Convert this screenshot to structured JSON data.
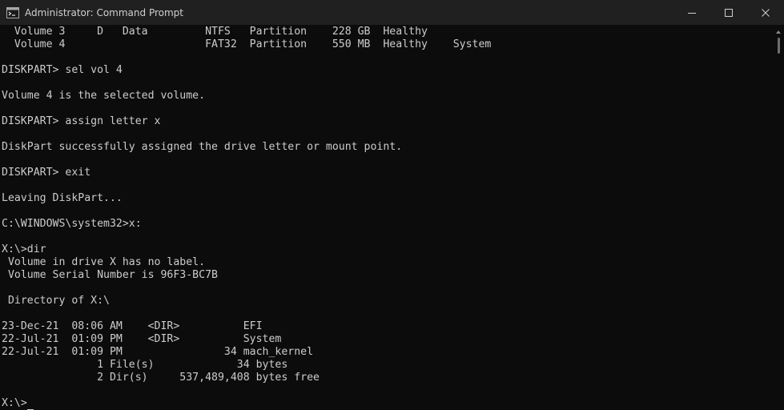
{
  "window": {
    "title": "Administrator: Command Prompt",
    "icon": "cmd-icon"
  },
  "controls": {
    "minimize": "minimize-icon",
    "maximize": "maximize-icon",
    "close": "close-icon"
  },
  "console": {
    "lines": [
      "  Volume 3     D   Data         NTFS   Partition    228 GB  Healthy",
      "  Volume 4                      FAT32  Partition    550 MB  Healthy    System",
      "",
      "DISKPART> sel vol 4",
      "",
      "Volume 4 is the selected volume.",
      "",
      "DISKPART> assign letter x",
      "",
      "DiskPart successfully assigned the drive letter or mount point.",
      "",
      "DISKPART> exit",
      "",
      "Leaving DiskPart...",
      "",
      "C:\\WINDOWS\\system32>x:",
      "",
      "X:\\>dir",
      " Volume in drive X has no label.",
      " Volume Serial Number is 96F3-BC7B",
      "",
      " Directory of X:\\",
      "",
      "23-Dec-21  08:06 AM    <DIR>          EFI",
      "22-Jul-21  01:09 PM    <DIR>          System",
      "22-Jul-21  01:09 PM                34 mach_kernel",
      "               1 File(s)             34 bytes",
      "               2 Dir(s)     537,489,408 bytes free",
      "",
      "X:\\>"
    ]
  }
}
